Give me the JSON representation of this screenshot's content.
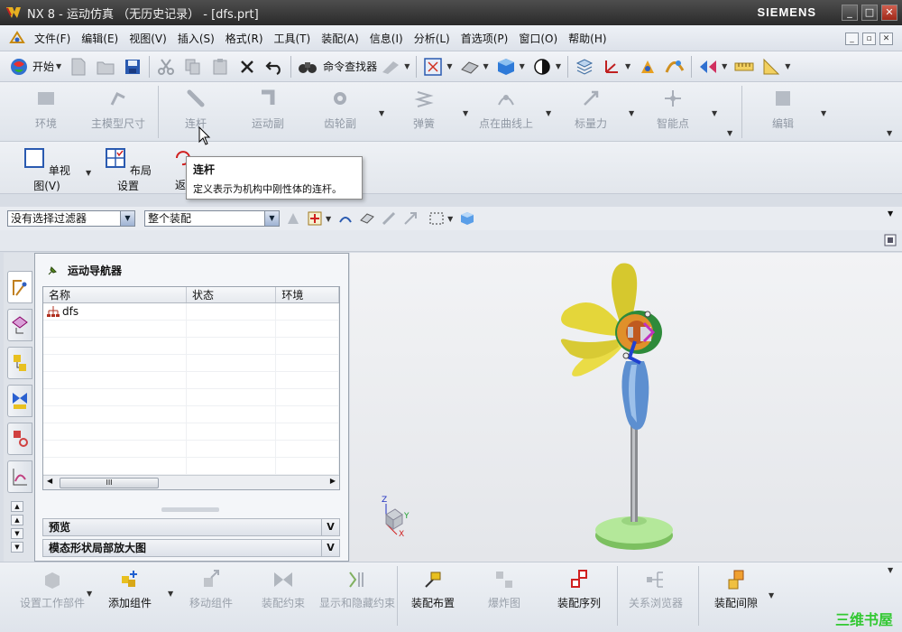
{
  "window": {
    "title": "NX 8 - 运动仿真 （无历史记录） - [dfs.prt]",
    "brand": "SIEMENS",
    "minimize": "_",
    "maximize": "□",
    "close": "✕"
  },
  "menubar": {
    "items": [
      "文件(F)",
      "编辑(E)",
      "视图(V)",
      "插入(S)",
      "格式(R)",
      "工具(T)",
      "装配(A)",
      "信息(I)",
      "分析(L)",
      "首选项(P)",
      "窗口(O)",
      "帮助(H)"
    ]
  },
  "toolbar": {
    "start_label": "开始",
    "command_finder_label": "命令查找器"
  },
  "motion_ribbon": {
    "items": [
      "环境",
      "主模型尺寸",
      "连杆",
      "运动副",
      "齿轮副",
      "弹簧",
      "点在曲线上",
      "标量力",
      "智能点",
      "编辑"
    ]
  },
  "layout_ribbon": {
    "single_view": "单视图(V)",
    "layout_settings": "布局设置",
    "back_partial": "返"
  },
  "tooltip": {
    "title": "连杆",
    "body": "定义表示为机构中刚性体的连杆。"
  },
  "selection": {
    "filter_value": "没有选择过滤器",
    "scope_value": "整个装配"
  },
  "navigator": {
    "title": "运动导航器",
    "columns": [
      "名称",
      "状态",
      "环境"
    ],
    "rows": [
      {
        "name": "dfs",
        "status": "",
        "env": ""
      }
    ],
    "scroll_thumb": "III",
    "sections": [
      "预览",
      "模态形状局部放大图"
    ]
  },
  "triad": {
    "z": "Z",
    "y": "Y",
    "x": "X"
  },
  "bottom_toolbar": {
    "items": [
      {
        "label": "设置工作部件",
        "enabled": false
      },
      {
        "label": "添加组件",
        "enabled": true
      },
      {
        "label": "移动组件",
        "enabled": false
      },
      {
        "label": "装配约束",
        "enabled": false
      },
      {
        "label": "显示和隐藏约束",
        "enabled": false
      },
      {
        "label": "装配布置",
        "enabled": true
      },
      {
        "label": "爆炸图",
        "enabled": false
      },
      {
        "label": "装配序列",
        "enabled": true
      },
      {
        "label": "关系浏览器",
        "enabled": false
      },
      {
        "label": "装配间隙",
        "enabled": true
      }
    ]
  },
  "watermark": "三维书屋",
  "colors": {
    "fan_blade": "#e4d63a",
    "fan_pole": "#5d8fd0",
    "fan_base": "#a8e08a",
    "title_bar": "#333333"
  }
}
